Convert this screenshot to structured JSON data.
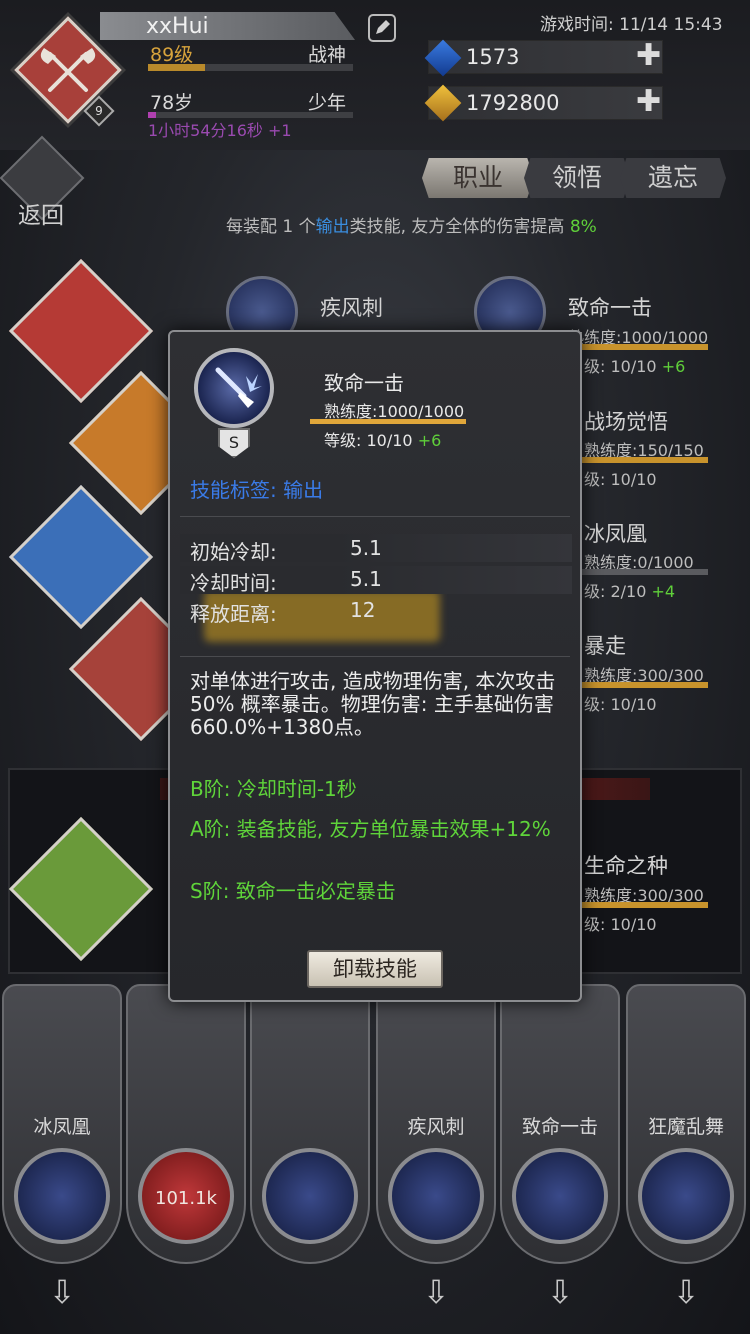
{
  "player": {
    "name": "xxHui",
    "level_text": "89级",
    "rank_title": "战神",
    "age_text": "78岁",
    "life_stage": "少年",
    "timer_text": "1小时54分16秒 +1",
    "avatar_badge": "9"
  },
  "game_time": "游戏时间: 11/14 15:43",
  "resources": [
    {
      "icon": "blue-gem-icon",
      "value": "1573",
      "color": "#3a7be0"
    },
    {
      "icon": "gold-gem-icon",
      "value": "1792800",
      "color": "#f0c13c"
    }
  ],
  "nav": {
    "back_label": "返回",
    "tabs": [
      "职业",
      "领悟",
      "遗忘"
    ]
  },
  "tip": {
    "part1": "每装配 1 个",
    "highlight": "输出",
    "part2": "类技能, 友方全体的伤害提高",
    "percent": "8%"
  },
  "background_skills": [
    {
      "name": "疾风刺"
    },
    {
      "name": "致命一击",
      "mastery": "熟练度:1000/1000",
      "level": "级: 10/10",
      "bonus": "+6"
    },
    {
      "name": "战场觉悟",
      "mastery": "熟练度:150/150",
      "level": "级: 10/10"
    },
    {
      "name": "冰凤凰",
      "mastery": "熟练度:0/1000",
      "level": "级: 2/10",
      "bonus": "+4"
    },
    {
      "name": "暴走",
      "mastery": "熟练度:300/300",
      "level": "级: 10/10"
    },
    {
      "name": "生命之种",
      "mastery": "熟练度:300/300",
      "level": "级: 10/10"
    }
  ],
  "slots": [
    {
      "label": "冰凤凰"
    },
    {
      "label": "",
      "damage": "101.1k"
    },
    {
      "label": ""
    },
    {
      "label": "疾风刺"
    },
    {
      "label": "致命一击"
    },
    {
      "label": "狂魔乱舞"
    }
  ],
  "popup": {
    "grade": "S",
    "name": "致命一击",
    "mastery": "熟练度:1000/1000",
    "level": "等级: 10/10",
    "level_bonus": "+6",
    "tag": "技能标签: 输出",
    "stats": [
      {
        "key": "初始冷却:",
        "value": "5.1"
      },
      {
        "key": "冷却时间:",
        "value": "5.1"
      },
      {
        "key": "释放距离:",
        "value": "12"
      }
    ],
    "description": "对单体进行攻击, 造成物理伤害, 本次攻击 50% 概率暴击。物理伤害: 主手基础伤害660.0%+1380点。",
    "tiers": [
      "B阶: 冷却时间-1秒",
      "A阶: 装备技能, 友方单位暴击效果+12%",
      "S阶: 致命一击必定暴击"
    ],
    "unload_label": "卸载技能"
  }
}
